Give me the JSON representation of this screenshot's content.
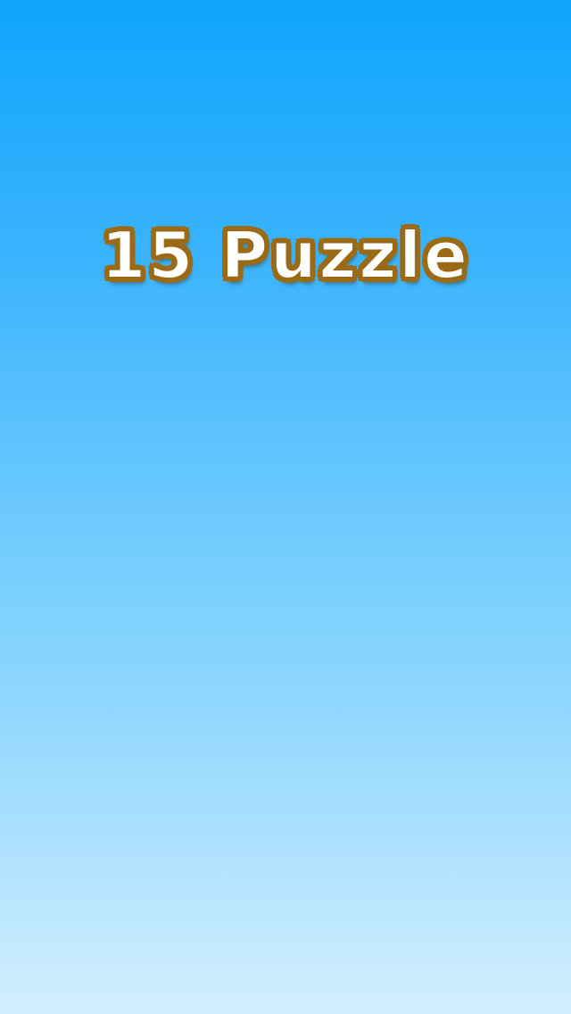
{
  "title_screen": {
    "title": "15 Puzzle"
  },
  "colors": {
    "background_top": "#0ea5fc",
    "background_bottom": "#d2effd",
    "title_fill": "#ffffff",
    "title_outline": "#9a6a16"
  }
}
